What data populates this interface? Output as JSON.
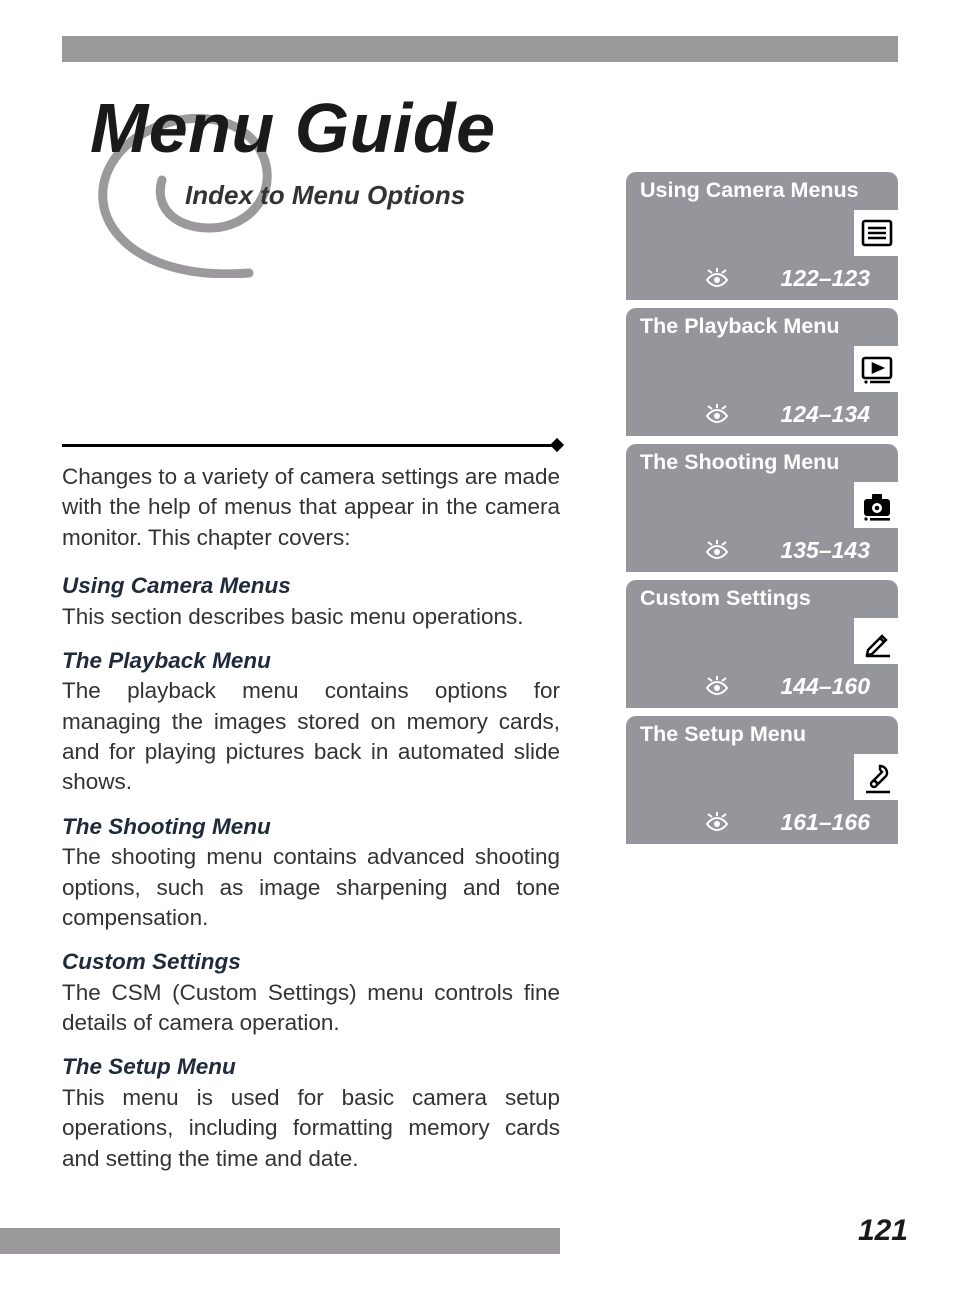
{
  "title": "Menu Guide",
  "subtitle": "Index to Menu Options",
  "intro": "Changes to a variety of camera settings are made with the help of menus that appear in the camera monitor.  This chapter covers:",
  "sections": [
    {
      "heading": "Using Camera Menus",
      "body": "This section describes basic menu operations."
    },
    {
      "heading": "The Playback Menu",
      "body": "The playback menu contains options for managing the images stored on memory cards, and for playing pictures back in automated slide shows."
    },
    {
      "heading": "The Shooting Menu",
      "body": "The shooting menu contains advanced shooting options, such as image sharpening and tone compensation."
    },
    {
      "heading": "Custom Settings",
      "body": "The CSM (Custom Settings) menu controls fine details of camera operation."
    },
    {
      "heading": "The Setup Menu",
      "body": "This menu is used for basic camera setup operations, including formatting memory cards and setting the time and date."
    }
  ],
  "sidebar": [
    {
      "title": "Using Camera Menus",
      "pages": "122–123",
      "icon": "menu-list-icon"
    },
    {
      "title": "The Playback Menu",
      "pages": "124–134",
      "icon": "playback-icon"
    },
    {
      "title": "The Shooting Menu",
      "pages": "135–143",
      "icon": "camera-icon"
    },
    {
      "title": "Custom Settings",
      "pages": "144–160",
      "icon": "pencil-icon"
    },
    {
      "title": "The Setup Menu",
      "pages": "161–166",
      "icon": "wrench-icon"
    }
  ],
  "page_number": "121"
}
